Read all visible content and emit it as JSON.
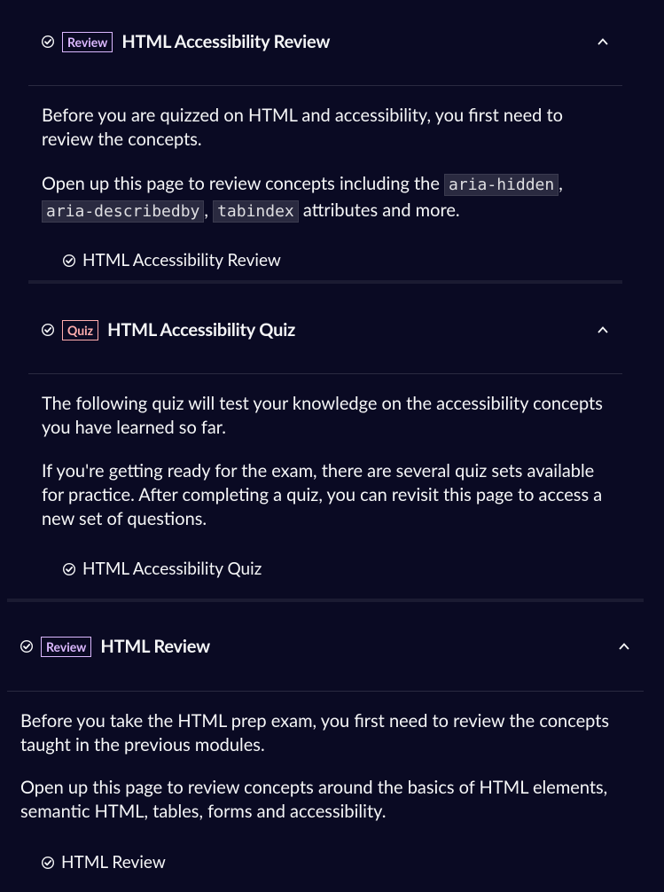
{
  "sections": [
    {
      "badge": "Review",
      "title": "HTML Accessibility Review",
      "paragraph1": "Before you are quizzed on HTML and accessibility, you first need to review the concepts.",
      "paragraph2_parts": {
        "prefix": "Open up this page to review concepts including the ",
        "code1": "aria-hidden",
        "sep1": ",",
        "code2": "aria-describedby",
        "sep2": ",",
        "code3": "tabindex",
        "suffix": " attributes and more."
      },
      "link": "HTML Accessibility Review"
    },
    {
      "badge": "Quiz",
      "title": "HTML Accessibility Quiz",
      "paragraph1": "The following quiz will test your knowledge on the accessibility concepts you have learned so far.",
      "paragraph2": "If you're getting ready for the exam, there are several quiz sets available for practice. After completing a quiz, you can revisit this page to access a new set of questions.",
      "link": "HTML Accessibility Quiz"
    },
    {
      "badge": "Review",
      "title": "HTML Review",
      "paragraph1": "Before you take the HTML prep exam, you first need to review the concepts taught in the previous modules.",
      "paragraph2": "Open up this page to review concepts around the basics of HTML elements, semantic HTML, tables, forms and accessibility.",
      "link": "HTML Review"
    }
  ],
  "colors": {
    "background": "#0a0a23",
    "text": "#f5f6f7",
    "review_badge": "#dbb8ff",
    "quiz_badge": "#ffadad"
  },
  "icons": {
    "completed": "check-circle-icon",
    "collapse": "chevron-up-icon"
  }
}
